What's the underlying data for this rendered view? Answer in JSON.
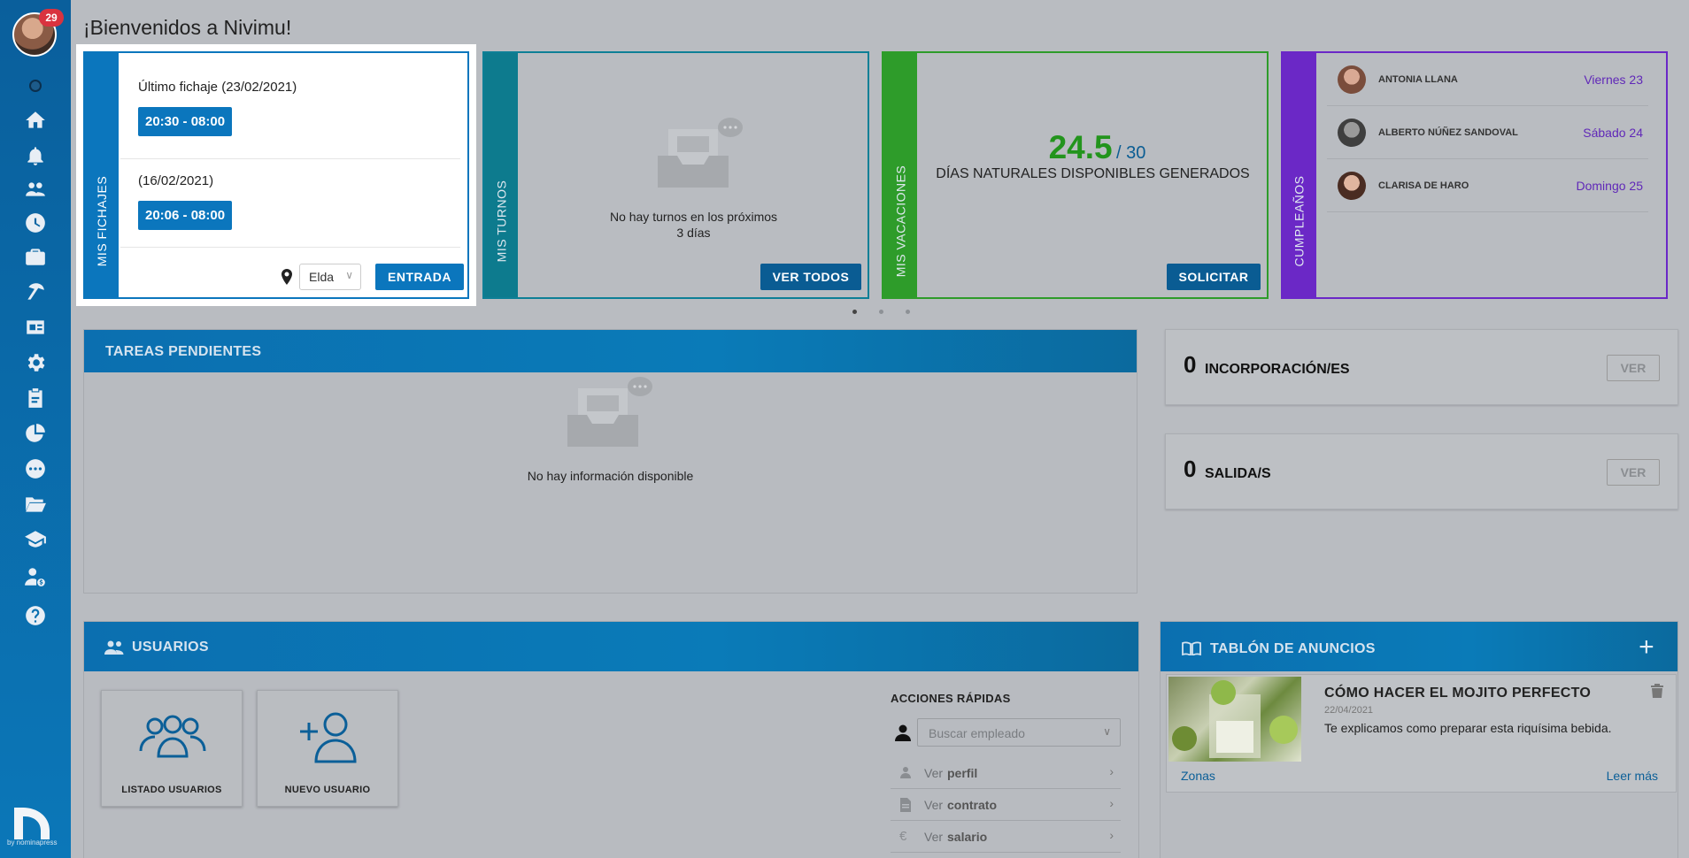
{
  "sidebar": {
    "notification_count": "29",
    "icons": [
      "home-icon",
      "bell-icon",
      "users-icon",
      "clock-icon",
      "briefcase-icon",
      "vacation-icon",
      "id-card-icon",
      "gear-icon",
      "clipboard-icon",
      "pie-chart-icon",
      "chat-icon",
      "folder-icon",
      "graduation-icon",
      "user-money-icon",
      "help-icon"
    ],
    "brand_text": "by nominapress"
  },
  "page_title": "¡Bienvenidos a Nivimu!",
  "fichajes": {
    "strip_label": "MIS FICHAJES",
    "entries": [
      {
        "label": "Último fichaje (23/02/2021)",
        "time": "20:30 - 08:00"
      },
      {
        "label": "(16/02/2021)",
        "time": "20:06 - 08:00"
      }
    ],
    "location": "Elda",
    "action_label": "ENTRADA"
  },
  "turnos": {
    "strip_label": "MIS TURNOS",
    "empty_line1": "No hay turnos en los próximos",
    "empty_line2": "3 días",
    "button_label": "VER TODOS"
  },
  "vacaciones": {
    "strip_label": "MIS VACACIONES",
    "available": "24.5",
    "total": "/ 30",
    "description": "DÍAS NATURALES DISPONIBLES GENERADOS",
    "button_label": "SOLICITAR"
  },
  "cumpleanos": {
    "strip_label": "CUMPLEAÑOS",
    "people": [
      {
        "name": "ANTONIA LLANA",
        "day": "Viernes  23"
      },
      {
        "name": "ALBERTO NÚÑEZ SANDOVAL",
        "day": "Sábado  24"
      },
      {
        "name": "CLARISA DE HARO",
        "day": "Domingo  25"
      }
    ]
  },
  "tareas": {
    "title": "TAREAS PENDIENTES",
    "empty_message": "No hay información disponible"
  },
  "incorporaciones": {
    "count": "0",
    "label": "INCORPORACIÓN/ES",
    "button": "VER"
  },
  "salidas": {
    "count": "0",
    "label": "SALIDA/S",
    "button": "VER"
  },
  "usuarios": {
    "title": "USUARIOS",
    "tiles": [
      {
        "label": "LISTADO USUARIOS"
      },
      {
        "label": "NUEVO USUARIO"
      }
    ],
    "quick_actions": {
      "title": "ACCIONES RÁPIDAS",
      "search_placeholder": "Buscar empleado",
      "items": [
        {
          "prefix": "Ver",
          "bold": "perfil"
        },
        {
          "prefix": "Ver",
          "bold": "contrato"
        },
        {
          "prefix": "Ver",
          "bold": "salario"
        }
      ]
    }
  },
  "anuncios": {
    "title": "TABLÓN DE ANUNCIOS",
    "post": {
      "title": "CÓMO HACER EL MOJITO PERFECTO",
      "date": "22/04/2021",
      "description": "Te explicamos como preparar esta riquísima bebida.",
      "tag": "Zonas",
      "more": "Leer más"
    }
  },
  "colors": {
    "primary": "#0b76bd",
    "turnos": "#0d7b8e",
    "vacaciones": "#2e9c2a",
    "cumpleanos": "#6b28c6",
    "badge": "#d9333f"
  }
}
